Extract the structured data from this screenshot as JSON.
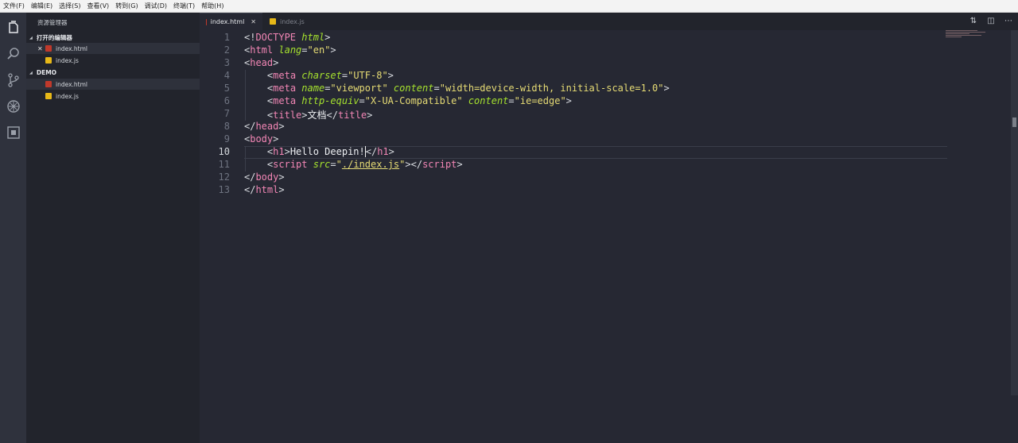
{
  "menu": [
    "文件(F)",
    "编辑(E)",
    "选择(S)",
    "查看(V)",
    "转到(G)",
    "调试(D)",
    "终端(T)",
    "帮助(H)"
  ],
  "activity_icons": [
    "files-icon",
    "search-icon",
    "source-control-icon",
    "debug-icon",
    "extensions-icon"
  ],
  "sidebar": {
    "title": "资源管理器",
    "open_editors_label": "打开的编辑器",
    "open_editors": [
      {
        "name": "index.html",
        "type": "html",
        "close": "✕"
      },
      {
        "name": "index.js",
        "type": "js"
      }
    ],
    "project_label": "DEMO",
    "project_files": [
      {
        "name": "index.html",
        "type": "html"
      },
      {
        "name": "index.js",
        "type": "js"
      }
    ]
  },
  "tabs": [
    {
      "label": "index.html",
      "close": "✕",
      "active": true
    },
    {
      "label": "index.js",
      "active": false
    }
  ],
  "toolbar": {
    "compare": "⇅",
    "split": "◫",
    "more": "⋯"
  },
  "editor": {
    "line_numbers": [
      "1",
      "2",
      "3",
      "4",
      "5",
      "6",
      "7",
      "8",
      "9",
      "10",
      "11",
      "12",
      "13"
    ],
    "current_line": "10",
    "lines": [
      [
        {
          "c": "tg",
          "t": "<!"
        },
        {
          "c": "tn",
          "t": "DOCTYPE"
        },
        {
          "c": "tx",
          "t": " "
        },
        {
          "c": "at",
          "t": "html"
        },
        {
          "c": "tg",
          "t": ">"
        }
      ],
      [
        {
          "c": "tg",
          "t": "<"
        },
        {
          "c": "tn",
          "t": "html"
        },
        {
          "c": "tx",
          "t": " "
        },
        {
          "c": "at",
          "t": "lang"
        },
        {
          "c": "tg",
          "t": "="
        },
        {
          "c": "st",
          "t": "\"en\""
        },
        {
          "c": "tg",
          "t": ">"
        }
      ],
      [
        {
          "c": "tg",
          "t": "<"
        },
        {
          "c": "tn",
          "t": "head"
        },
        {
          "c": "tg",
          "t": ">"
        }
      ],
      [
        {
          "c": "tx",
          "t": "    "
        },
        {
          "c": "tg",
          "t": "<"
        },
        {
          "c": "tn",
          "t": "meta"
        },
        {
          "c": "tx",
          "t": " "
        },
        {
          "c": "at",
          "t": "charset"
        },
        {
          "c": "tg",
          "t": "="
        },
        {
          "c": "st",
          "t": "\"UTF-8\""
        },
        {
          "c": "tg",
          "t": ">"
        }
      ],
      [
        {
          "c": "tx",
          "t": "    "
        },
        {
          "c": "tg",
          "t": "<"
        },
        {
          "c": "tn",
          "t": "meta"
        },
        {
          "c": "tx",
          "t": " "
        },
        {
          "c": "at",
          "t": "name"
        },
        {
          "c": "tg",
          "t": "="
        },
        {
          "c": "st",
          "t": "\"viewport\""
        },
        {
          "c": "tx",
          "t": " "
        },
        {
          "c": "at",
          "t": "content"
        },
        {
          "c": "tg",
          "t": "="
        },
        {
          "c": "st",
          "t": "\"width=device-width, initial-scale=1.0\""
        },
        {
          "c": "tg",
          "t": ">"
        }
      ],
      [
        {
          "c": "tx",
          "t": "    "
        },
        {
          "c": "tg",
          "t": "<"
        },
        {
          "c": "tn",
          "t": "meta"
        },
        {
          "c": "tx",
          "t": " "
        },
        {
          "c": "at",
          "t": "http-equiv"
        },
        {
          "c": "tg",
          "t": "="
        },
        {
          "c": "st",
          "t": "\"X-UA-Compatible\""
        },
        {
          "c": "tx",
          "t": " "
        },
        {
          "c": "at",
          "t": "content"
        },
        {
          "c": "tg",
          "t": "="
        },
        {
          "c": "st",
          "t": "\"ie=edge\""
        },
        {
          "c": "tg",
          "t": ">"
        }
      ],
      [
        {
          "c": "tx",
          "t": "    "
        },
        {
          "c": "tg",
          "t": "<"
        },
        {
          "c": "tn",
          "t": "title"
        },
        {
          "c": "tg",
          "t": ">"
        },
        {
          "c": "tx",
          "t": "文档"
        },
        {
          "c": "tg",
          "t": "</"
        },
        {
          "c": "tn",
          "t": "title"
        },
        {
          "c": "tg",
          "t": ">"
        }
      ],
      [
        {
          "c": "tg",
          "t": "</"
        },
        {
          "c": "tn",
          "t": "head"
        },
        {
          "c": "tg",
          "t": ">"
        }
      ],
      [
        {
          "c": "tg",
          "t": "<"
        },
        {
          "c": "tn",
          "t": "body"
        },
        {
          "c": "tg",
          "t": ">"
        }
      ],
      [
        {
          "c": "tx",
          "t": "    "
        },
        {
          "c": "tg",
          "t": "<"
        },
        {
          "c": "tn",
          "t": "h1"
        },
        {
          "c": "tg",
          "t": ">"
        },
        {
          "c": "tx",
          "t": "Hello Deepin!"
        },
        {
          "c": "tg cursor",
          "t": "</"
        },
        {
          "c": "tn",
          "t": "h1"
        },
        {
          "c": "tg",
          "t": ">"
        }
      ],
      [
        {
          "c": "tx",
          "t": "    "
        },
        {
          "c": "tg",
          "t": "<"
        },
        {
          "c": "tn",
          "t": "script"
        },
        {
          "c": "tx",
          "t": " "
        },
        {
          "c": "at",
          "t": "src"
        },
        {
          "c": "tg",
          "t": "="
        },
        {
          "c": "st",
          "t": "\""
        },
        {
          "c": "st ul",
          "t": "./index.js"
        },
        {
          "c": "st",
          "t": "\""
        },
        {
          "c": "tg",
          "t": "></"
        },
        {
          "c": "tn",
          "t": "script"
        },
        {
          "c": "tg",
          "t": ">"
        }
      ],
      [
        {
          "c": "tg",
          "t": "</"
        },
        {
          "c": "tn",
          "t": "body"
        },
        {
          "c": "tg",
          "t": ">"
        }
      ],
      [
        {
          "c": "tg",
          "t": "</"
        },
        {
          "c": "tn",
          "t": "html"
        },
        {
          "c": "tg",
          "t": ">"
        }
      ]
    ]
  },
  "colors": {
    "editor_bg": "#262833",
    "sidebar_bg": "#22242c",
    "tag": "#f286b5",
    "attr": "#a6e22e",
    "string": "#e6db74"
  }
}
